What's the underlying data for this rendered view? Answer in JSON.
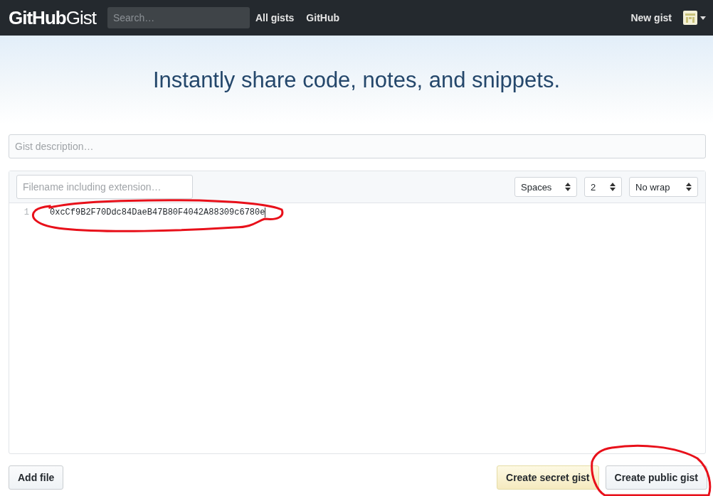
{
  "header": {
    "logo_bold": "GitHub",
    "logo_light": "Gist",
    "search": {
      "placeholder": "Search…"
    },
    "nav": [
      "All gists",
      "GitHub"
    ],
    "new_gist": "New gist"
  },
  "hero": {
    "title": "Instantly share code, notes, and snippets."
  },
  "description": {
    "placeholder": "Gist description…"
  },
  "editor": {
    "filename": {
      "placeholder": "Filename including extension…"
    },
    "selects": [
      {
        "value": "Spaces"
      },
      {
        "value": "2"
      },
      {
        "value": "No wrap"
      }
    ],
    "lines": [
      {
        "number": "1",
        "code": "0xcCf9B2F70Ddc84DaeB47B80F4042A88309c6780e"
      }
    ]
  },
  "buttons": [
    {
      "label": "Add file",
      "kind": "plain"
    },
    {
      "label": "Create secret gist",
      "kind": "secret"
    },
    {
      "label": "Create public gist",
      "kind": "plain"
    }
  ]
}
